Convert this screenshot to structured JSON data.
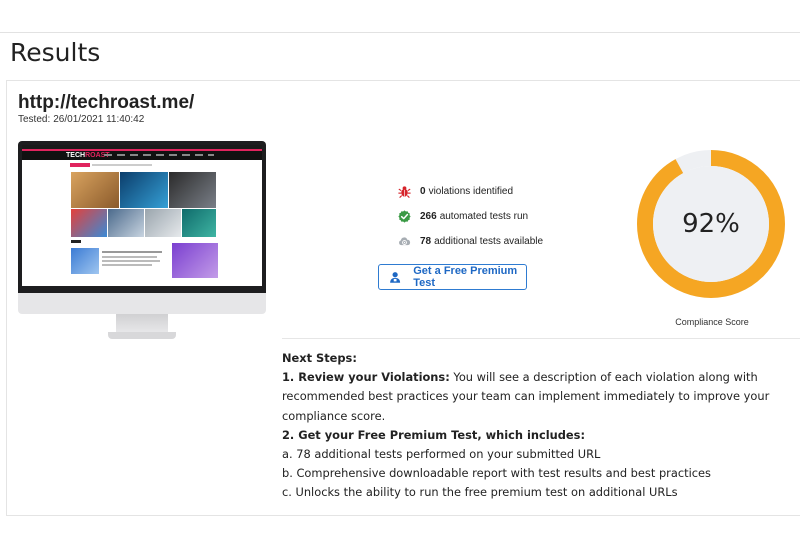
{
  "page": {
    "title": "Results"
  },
  "site": {
    "url": "http://techroast.me/",
    "tested_label": "Tested:",
    "tested_at": "26/01/2021 11:40:42",
    "logo_left": "TECH",
    "logo_right": "ROAST"
  },
  "stats": {
    "violations": {
      "count": "0",
      "text": "violations identified",
      "icon": "bug-icon",
      "color": "#d6242b"
    },
    "automated": {
      "count": "266",
      "text": "automated tests run",
      "icon": "check-circle-icon",
      "color": "#3a9a45"
    },
    "additional": {
      "count": "78",
      "text": "additional tests available",
      "icon": "cloud-gear-icon",
      "color": "#a7adb3"
    }
  },
  "premium_button": {
    "label": "Get a Free Premium Test",
    "icon": "person-badge-icon",
    "color": "#2e7bd1"
  },
  "score": {
    "value": "92%",
    "percent": 92,
    "label": "Compliance Score",
    "ring_color": "#f5a623",
    "track_color": "#eef0f3"
  },
  "next_steps": {
    "heading": "Next Steps:",
    "step1_title": "1. Review your Violations:",
    "step1_line1": " You will see a description of each violation along with",
    "step1_line2": "recommended best practices your team can implement immediately to improve your",
    "step1_line3": "compliance score.",
    "step2_title": "2. Get your Free Premium Test, which includes:",
    "item_a": "a. 78 additional tests performed on your submitted URL",
    "item_b": "b. Comprehensive downloadable report with test results and best practices",
    "item_c": "c. Unlocks the ability to run the free premium test on additional URLs"
  }
}
